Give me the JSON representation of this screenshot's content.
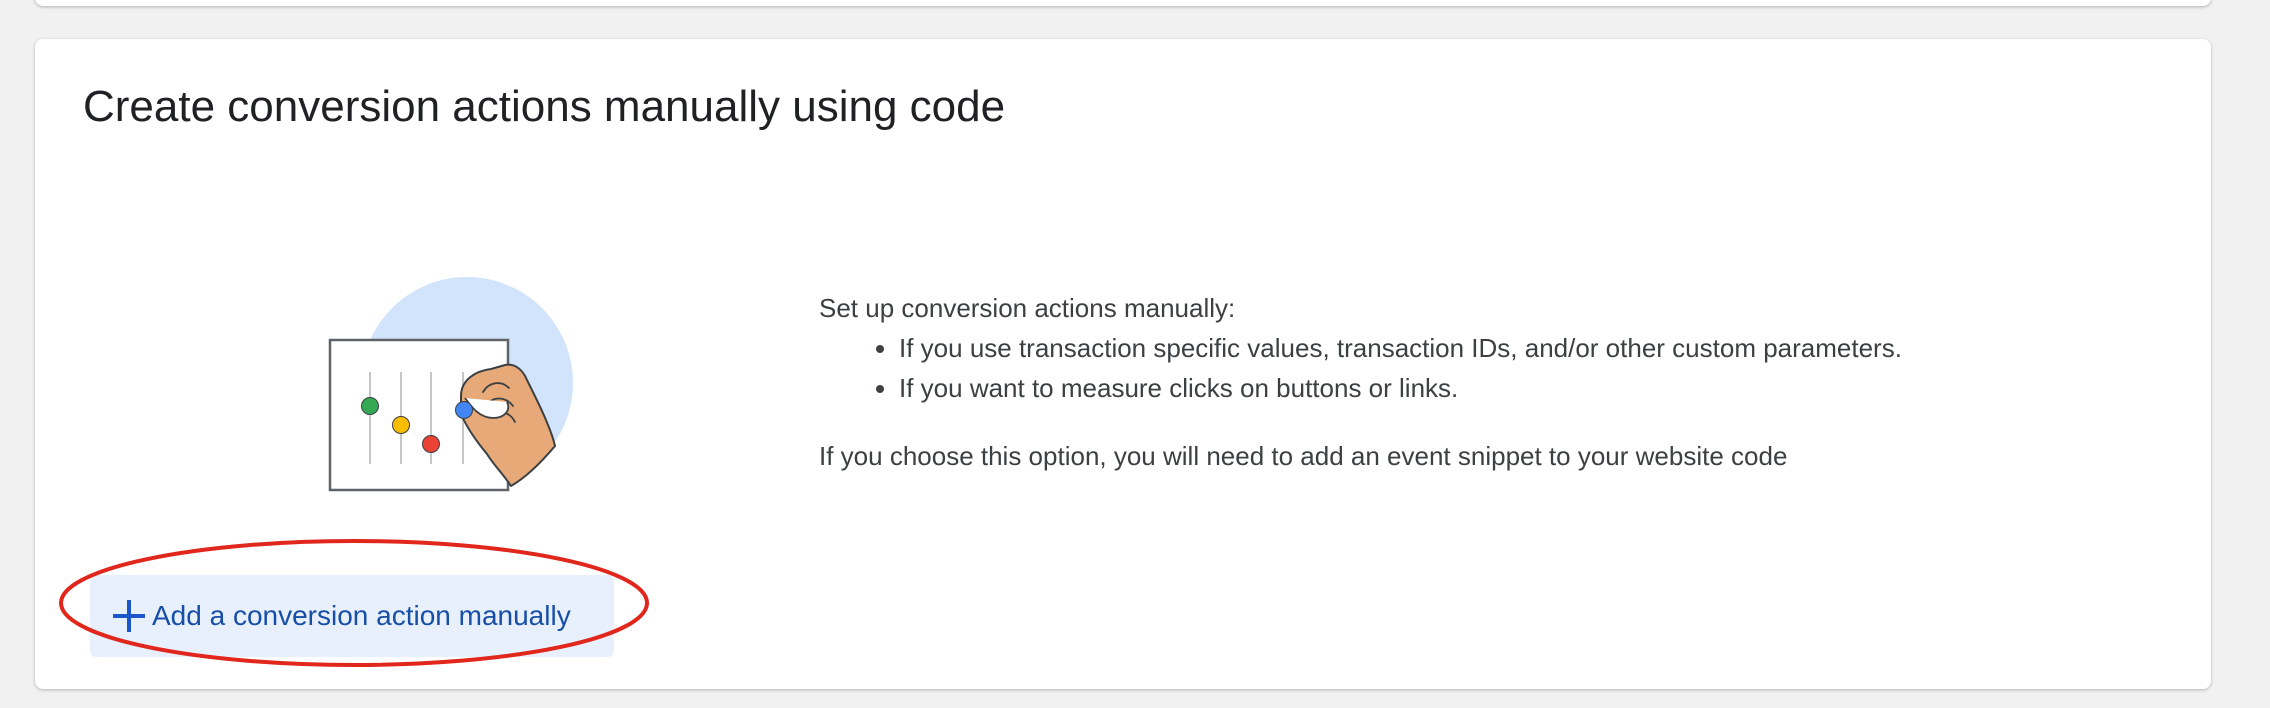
{
  "card": {
    "title": "Create conversion actions manually using code",
    "intro": "Set up conversion actions manually:",
    "bullets": [
      "If you use transaction specific values, transaction IDs, and/or other custom parameters.",
      "If you want to measure clicks on buttons or links."
    ],
    "note": "If you choose this option, you will need to add an event snippet to your website code"
  },
  "add_button": {
    "icon": "plus-icon",
    "label": "Add a conversion action manually"
  },
  "illustration": {
    "icon": "equalizer-sliders-hand-illustration",
    "colors": {
      "circle": "#d2e3fc",
      "green": "#34a853",
      "yellow": "#fbbc04",
      "red": "#ea4335",
      "blue": "#4285f4",
      "skin": "#e6a977"
    }
  },
  "annotation": {
    "icon": "red-highlight-ellipse",
    "color": "#e1261c"
  }
}
